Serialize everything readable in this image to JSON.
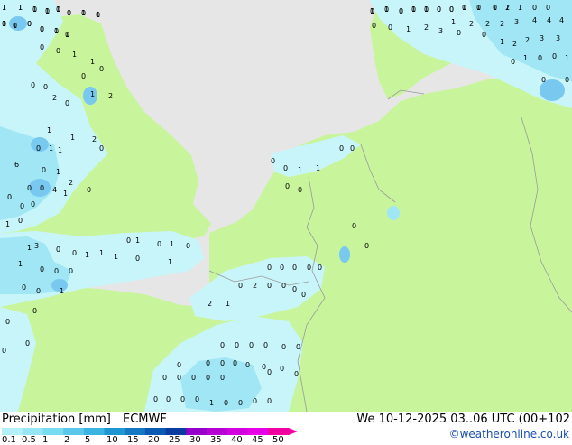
{
  "footer": {
    "title": "Precipitation [mm]",
    "model": "ECMWF",
    "datetime": "We 10-12-2025 03..06 UTC (00+102",
    "credit": "©weatheronline.co.uk"
  },
  "colorbar": {
    "ticks": [
      "0.1",
      "0.5",
      "1",
      "2",
      "5",
      "10",
      "15",
      "20",
      "25",
      "30",
      "35",
      "40",
      "45",
      "50"
    ],
    "colors": [
      "#b4f0fa",
      "#96e6f5",
      "#78dcf0",
      "#5ac8ea",
      "#3cb4e1",
      "#1e96d2",
      "#1478c3",
      "#0a5ab4",
      "#0a3ca0",
      "#9600c8",
      "#b400d2",
      "#d200dc",
      "#e600e6",
      "#f000a0"
    ]
  },
  "map_colors": {
    "sea": "#e6e6e6",
    "land_dry": "#c8f59b",
    "precip_light": "#c8f5fa",
    "precip_moderate": "#a0e6f5",
    "precip_heavy": "#78c8f0",
    "border": "#9a9a9a"
  },
  "labels": [
    "1",
    "1",
    "0",
    "0",
    "0",
    "0",
    "0",
    "0",
    "0",
    "0",
    "0",
    "0",
    "0",
    "0",
    "0",
    "0",
    "0",
    "1",
    "1",
    "0",
    "0",
    "1",
    "1",
    "1",
    "2",
    "1",
    "0",
    "0",
    "1",
    "2",
    "2",
    "2",
    "3",
    "4",
    "4",
    "4",
    "1",
    "2",
    "2",
    "3",
    "3",
    "0",
    "0",
    "1",
    "2",
    "3",
    "0",
    "0",
    "0",
    "1",
    "0",
    "0",
    "1",
    "0",
    "0",
    "0",
    "0",
    "1",
    "1",
    "0",
    "0",
    "1",
    "2",
    "0",
    "0",
    "2",
    "0",
    "1",
    "1",
    "2",
    "0",
    "0",
    "1",
    "1",
    "6",
    "0",
    "1",
    "2",
    "0",
    "0",
    "0",
    "4",
    "1",
    "0",
    "0",
    "0",
    "1",
    "0",
    "1",
    "3",
    "0",
    "0",
    "1",
    "1",
    "1",
    "0",
    "1",
    "0",
    "1",
    "0",
    "1",
    "0",
    "1",
    "0",
    "0",
    "0",
    "0",
    "0",
    "1",
    "0",
    "0",
    "0",
    "0",
    "2",
    "1",
    "0",
    "2",
    "0",
    "0",
    "0",
    "0",
    "0",
    "0",
    "0",
    "0",
    "0",
    "0",
    "0",
    "1",
    "1",
    "0",
    "0",
    "0",
    "0",
    "0",
    "0",
    "0",
    "0",
    "0",
    "0",
    "0",
    "0",
    "0",
    "0",
    "0",
    "0",
    "0",
    "0",
    "0",
    "0",
    "0",
    "0",
    "0",
    "0",
    "1",
    "0",
    "0",
    "0",
    "0",
    "0",
    "0",
    "0",
    "0",
    "0",
    "0",
    "1",
    "1",
    "1",
    "1",
    "1",
    "0",
    "1",
    "1",
    "1",
    "1",
    "0",
    "0",
    "1",
    "1",
    "1",
    "1",
    "0",
    "0",
    "0",
    "0",
    "0",
    "0",
    "0",
    "0",
    "1"
  ]
}
